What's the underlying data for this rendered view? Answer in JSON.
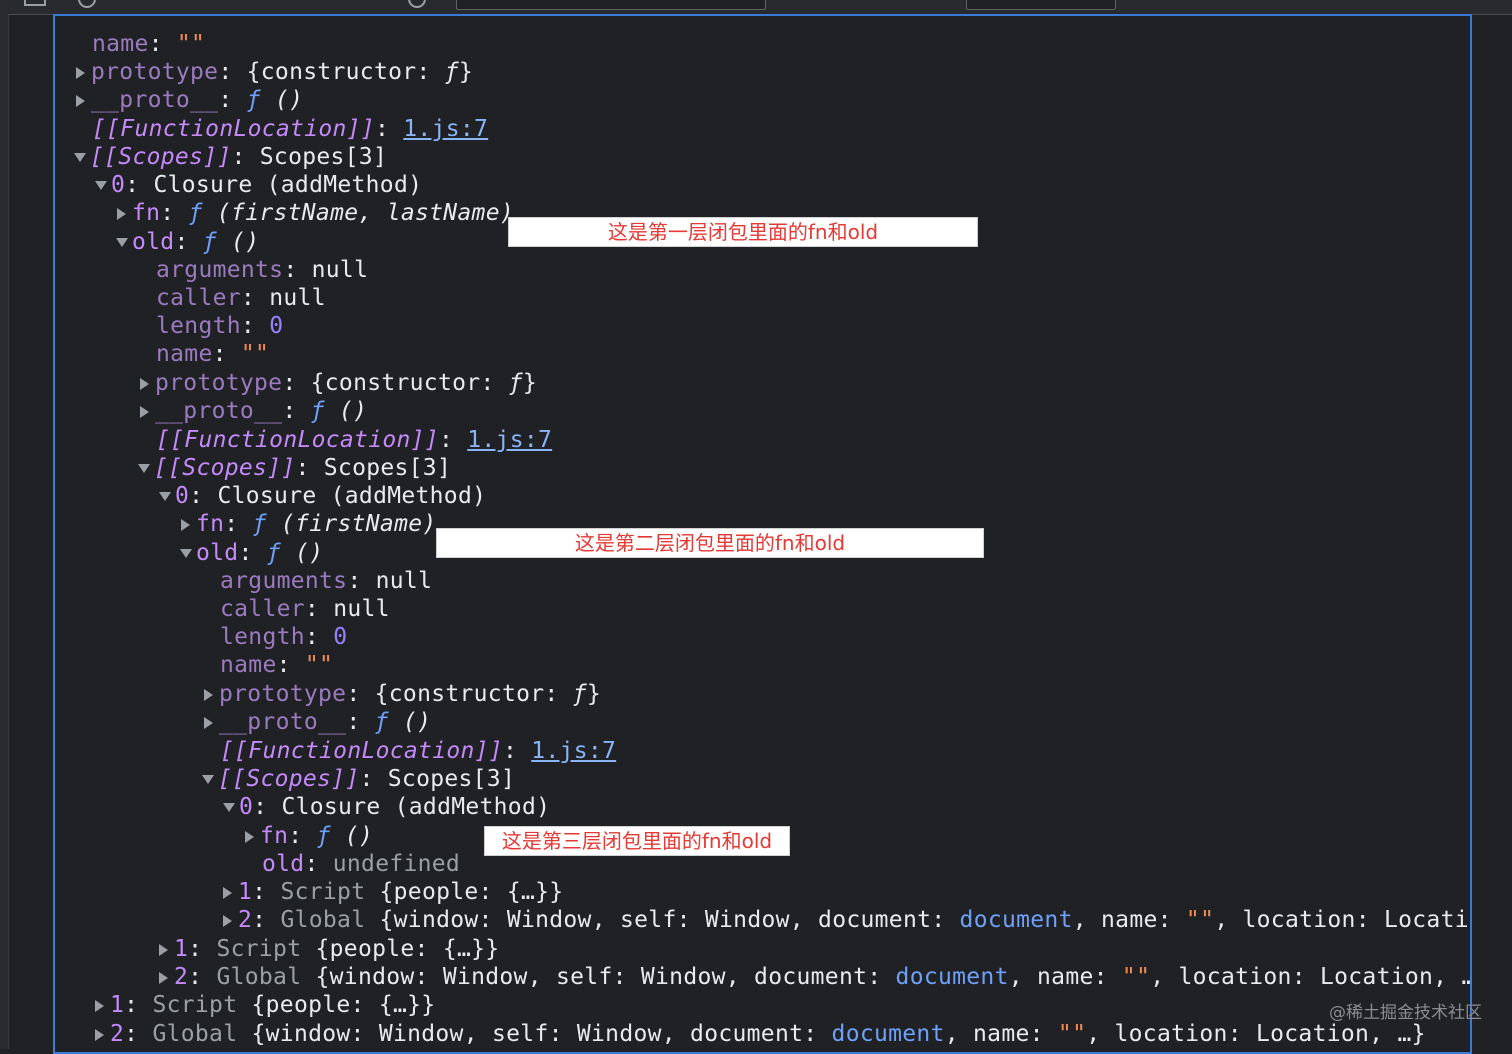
{
  "tree": {
    "r_name_top_key": "name",
    "r_name_top_val": "\"\"",
    "prototype_key": "prototype",
    "constructor_val_open": "{constructor: ",
    "f_sym": "ƒ",
    "brace_close": "}",
    "proto_key": "__proto__",
    "paren_empty": "()",
    "func_loc_key": "[[FunctionLocation]]",
    "func_loc_link": "1.js:7",
    "scopes_key": "[[Scopes]]",
    "scopes_val": "Scopes[3]",
    "closure_idx": "0",
    "closure_val": "Closure (addMethod)",
    "fn_key": "fn",
    "fn1_params": "(firstName, lastName)",
    "fn2_params": "(firstName)",
    "old_key": "old",
    "arguments_key": "arguments",
    "null_val": "null",
    "caller_key": "caller",
    "length_key": "length",
    "zero_val": "0",
    "undefined_val": "undefined",
    "script_idx": "1",
    "script_label": "Script",
    "script_val": "{people: {…}}",
    "global_idx": "2",
    "global_label": "Global",
    "global_val_a": "{window: Window, self: Window, document: ",
    "document_link": "document",
    "global_val_b": ", name: ",
    "empty_str": "\"\"",
    "global_val_c": ", location: Location, …}",
    "global_val_c_trunc": ", location: Locatio…"
  },
  "annotations": {
    "layer1": "这是第一层闭包里面的fn和old",
    "layer2": "这是第二层闭包里面的fn和old",
    "layer3": "这是第三层闭包里面的fn和old"
  },
  "watermark": "@稀土掘金技术社区",
  "colors": {
    "background": "#202124",
    "key_purple": "#c58af9",
    "function_blue": "#6ea0f8",
    "link_blue": "#8ab4f8",
    "string_orange": "#f28b54",
    "annotation_red": "#e53935",
    "focus_border": "#3a7bd5"
  }
}
